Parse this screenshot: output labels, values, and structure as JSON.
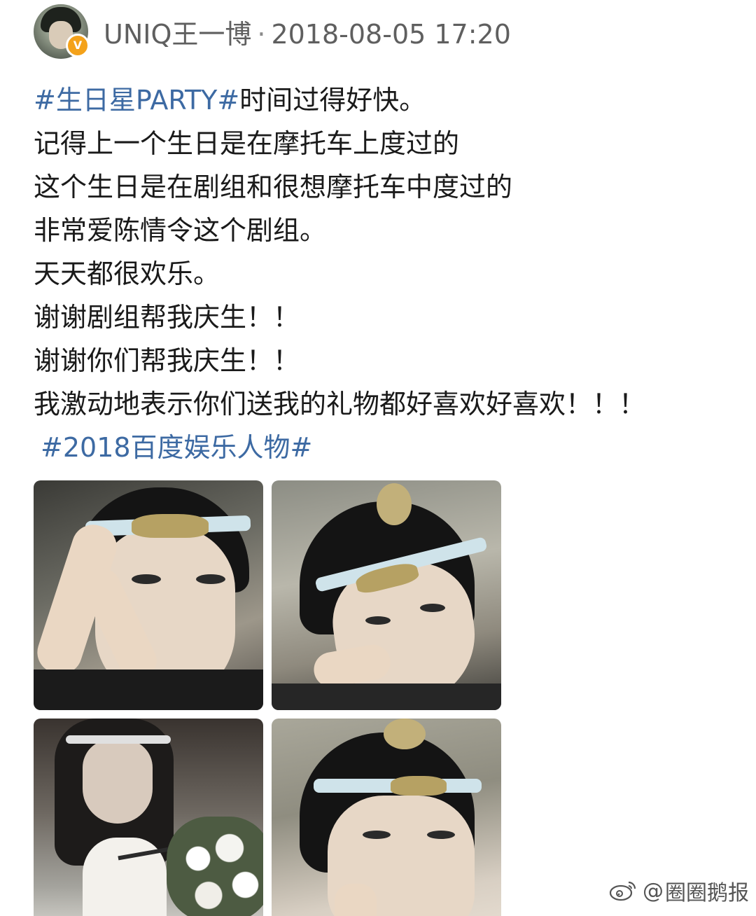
{
  "header": {
    "username": "UNIQ王一博",
    "separator": "·",
    "timestamp": "2018-08-05 17:20",
    "badge": "V"
  },
  "post": {
    "hashtag_1": "#生日星PARTY#",
    "line_1_rest": "时间过得好快。",
    "line_2": "记得上一个生日是在摩托车上度过的",
    "line_3": "这个生日是在剧组和很想摩托车中度过的",
    "line_4": "非常爱陈情令这个剧组。",
    "line_5": "天天都很欢乐。",
    "line_6": "谢谢剧组帮我庆生！！",
    "line_7": "谢谢你们帮我庆生！！",
    "line_8": "我激动地表示你们送我的礼物都好喜欢好喜欢！！！",
    "hashtag_2": "#2018百度娱乐人物#"
  },
  "watermark": {
    "at": "@",
    "name": "圈圈鹅报",
    "icon": "weibo-icon"
  },
  "colors": {
    "hashtag": "#3d6aa3",
    "badge": "#f4a21a",
    "text": "#1a1a1a",
    "meta": "#5f5f5f"
  }
}
